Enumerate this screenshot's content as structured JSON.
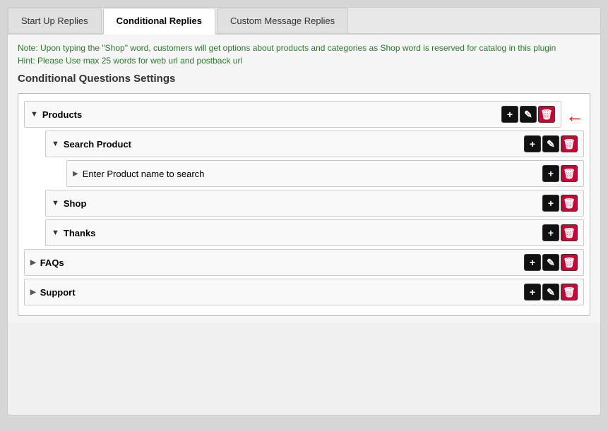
{
  "tabs": [
    {
      "id": "startup",
      "label": "Start Up Replies",
      "active": false
    },
    {
      "id": "conditional",
      "label": "Conditional Replies",
      "active": true
    },
    {
      "id": "custom",
      "label": "Custom Message Replies",
      "active": false
    }
  ],
  "notice": {
    "line1": "Note: Upon typing the \"Shop\" word, customers will get options about products and categories as Shop word is reserved for catalog in this plugin",
    "line2": "Hint: Please Use max 25 words for web url and postback url"
  },
  "section_title": "Conditional Questions Settings",
  "tree": [
    {
      "id": "products",
      "level": 0,
      "toggle": "▼",
      "label": "Products",
      "buttons": [
        "add",
        "edit",
        "trash"
      ],
      "has_arrow": true,
      "children": [
        {
          "id": "search-product",
          "level": 1,
          "toggle": "▼",
          "label": "Search Product",
          "buttons": [
            "add",
            "edit",
            "trash"
          ],
          "has_arrow": false,
          "children": [
            {
              "id": "enter-product",
              "level": 2,
              "toggle": "▶",
              "label": "Enter Product name to search",
              "buttons": [
                "add",
                "trash"
              ],
              "has_arrow": false
            }
          ]
        },
        {
          "id": "shop",
          "level": 1,
          "toggle": "▼",
          "label": "Shop",
          "buttons": [
            "add",
            "trash"
          ],
          "has_arrow": false
        },
        {
          "id": "thanks",
          "level": 1,
          "toggle": "▼",
          "label": "Thanks",
          "buttons": [
            "add",
            "trash"
          ],
          "has_arrow": false
        }
      ]
    },
    {
      "id": "faqs",
      "level": 0,
      "toggle": "▶",
      "label": "FAQs",
      "buttons": [
        "add",
        "edit",
        "trash"
      ],
      "has_arrow": false
    },
    {
      "id": "support",
      "level": 0,
      "toggle": "▶",
      "label": "Support",
      "buttons": [
        "add",
        "edit",
        "trash"
      ],
      "has_arrow": false
    }
  ],
  "icons": {
    "add": "+",
    "edit": "✎",
    "trash": "🗑"
  }
}
